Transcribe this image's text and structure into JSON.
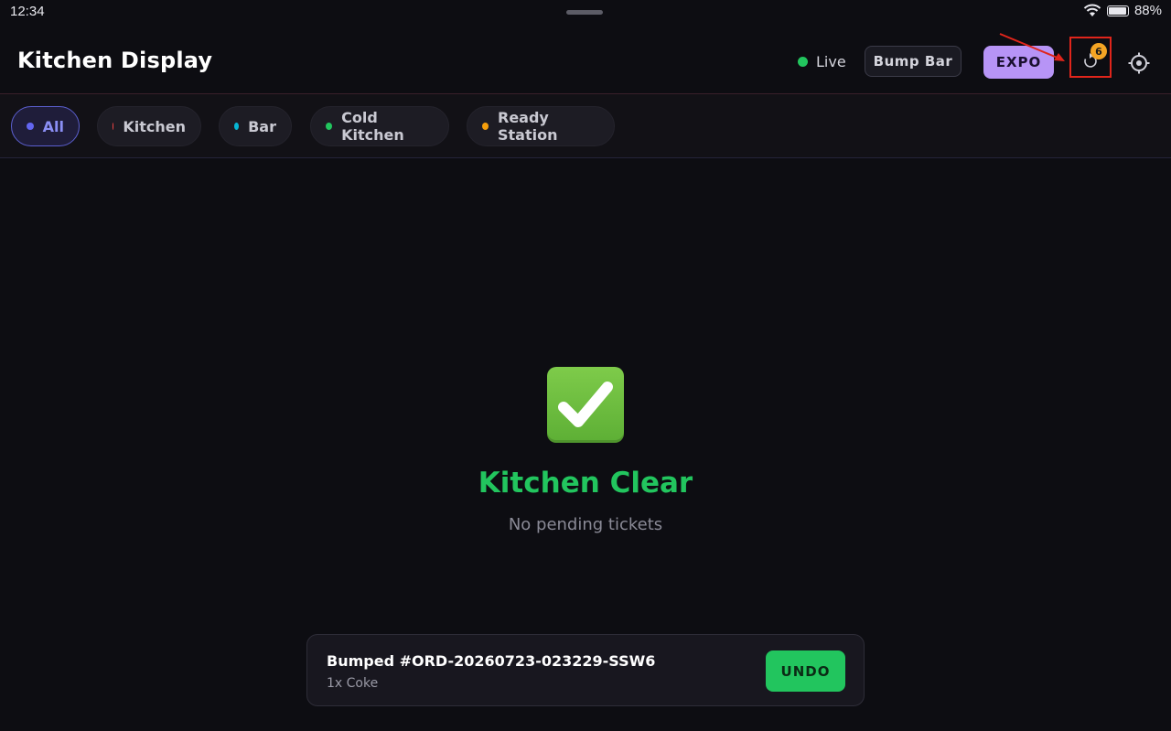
{
  "status_bar": {
    "time": "12:34",
    "battery": "88%",
    "icons": [
      "wifi-icon",
      "battery-icon"
    ]
  },
  "header": {
    "title": "Kitchen Display",
    "live_label": "Live",
    "live_color": "#22c55e",
    "bump_bar_label": "Bump Bar",
    "expo_label": "EXPO",
    "recall_badge_count": "6",
    "recall_icon": "undo-icon",
    "settings_icon": "gear-icon"
  },
  "filters": [
    {
      "label": "All",
      "dot_color": "#6366f1",
      "active": true
    },
    {
      "label": "Kitchen",
      "dot_color": "#ef4444",
      "active": false
    },
    {
      "label": "Bar",
      "dot_color": "#06b6d4",
      "active": false
    },
    {
      "label": "Cold Kitchen",
      "dot_color": "#22c55e",
      "active": false
    },
    {
      "label": "Ready Station",
      "dot_color": "#f59e0b",
      "active": false
    }
  ],
  "empty_state": {
    "icon": "check-mark-icon",
    "title": "Kitchen Clear",
    "subtitle": "No pending tickets"
  },
  "toast": {
    "title": "Bumped #ORD-20260723-023229-SSW6",
    "subtitle": "1x Coke",
    "undo_label": "UNDO"
  },
  "colors": {
    "background": "#0d0d12",
    "accent_purple": "#b794f6",
    "success_green": "#22c55e",
    "badge_orange": "#f5a524",
    "annotation_red": "#e0251b"
  }
}
